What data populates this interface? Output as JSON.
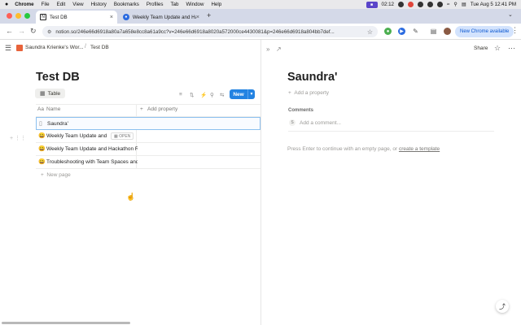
{
  "menubar": {
    "apple": "",
    "app": "Chrome",
    "items": [
      "File",
      "Edit",
      "View",
      "History",
      "Bookmarks",
      "Profiles",
      "Tab",
      "Window",
      "Help"
    ],
    "timer": "02:12",
    "datetime": "Tue Aug 5  12:41 PM"
  },
  "tabs": [
    {
      "title": "Test DB",
      "active": true
    },
    {
      "title": "Weekly Team Update and Hac",
      "active": false
    }
  ],
  "toolbar": {
    "url": "notion.so/246e66d6918a80a7a658e8cc8a61a9cc?v=246e66d6918a8020a572000ce4430081&p=246e66d6918a804bb7def...",
    "chrome_available": "New Chrome available"
  },
  "header": {
    "workspace": "Saundra Krienke's Wor...",
    "page": "Test DB"
  },
  "db": {
    "title": "Test DB",
    "view_tab": "Table",
    "new_button": "New",
    "columns": {
      "name": "Name",
      "add_property": "Add property"
    },
    "rows": [
      {
        "icon": "page-icon",
        "title": "Saundra'",
        "selected": true
      },
      {
        "icon": "emoji-icon",
        "title": "Weekly Team Update and Hackathon Recap",
        "selected": false,
        "open_label": "OPEN"
      },
      {
        "icon": "emoji-icon",
        "title": "Weekly Team Update and Hackathon Recap",
        "selected": false
      },
      {
        "icon": "emoji-icon",
        "title": "Troubleshooting with Team Spaces and Permissions",
        "selected": false
      }
    ],
    "new_page": "New page"
  },
  "peek": {
    "share": "Share",
    "title": "Saundra'",
    "add_property": "Add a property",
    "comments_label": "Comments",
    "avatar_initial": "S",
    "comment_placeholder": "Add a comment...",
    "hint_text": "Press Enter to continue with an empty page, or ",
    "hint_link": "create a template"
  },
  "colors": {
    "accent": "#2383e2",
    "tabstrip": "#d4d9e8",
    "selection_border": "#8cc0ef"
  }
}
